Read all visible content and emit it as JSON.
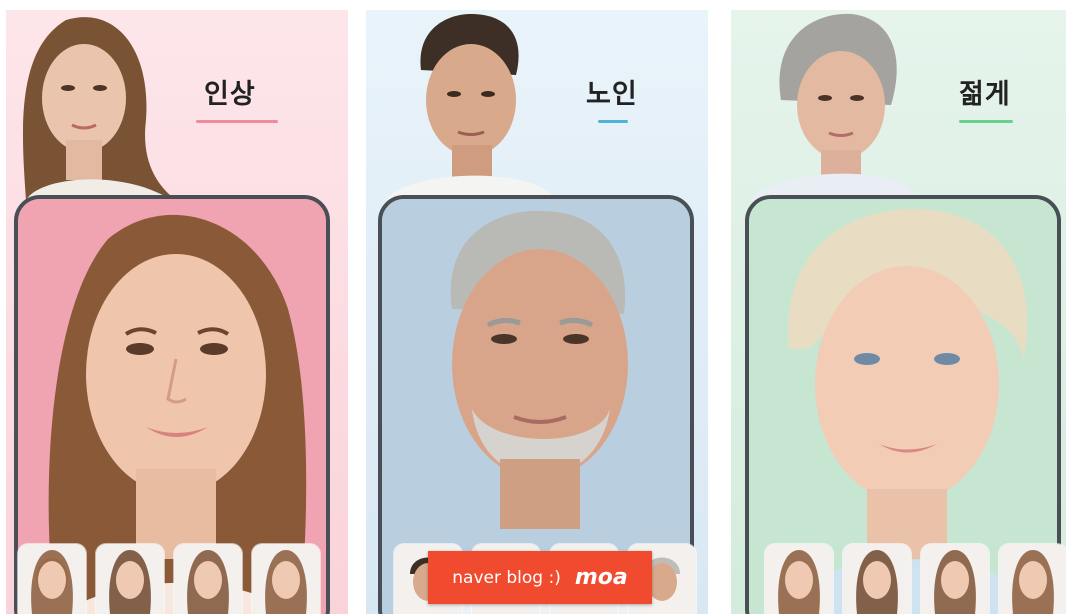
{
  "panels": [
    {
      "caption": "인상",
      "accent": "#f08c99",
      "top_face": "young-woman-portrait",
      "main_face": "smiling-woman-photo"
    },
    {
      "caption": "노인",
      "accent": "#4fb3d9",
      "top_face": "man-portrait",
      "main_face": "aged-man-photo"
    },
    {
      "caption": "젊게",
      "accent": "#68d08f",
      "top_face": "older-woman-portrait",
      "main_face": "young-blonde-woman-photo"
    }
  ],
  "banner": {
    "text": "naver blog :)",
    "brand": "moa",
    "color": "#f04a2f"
  }
}
